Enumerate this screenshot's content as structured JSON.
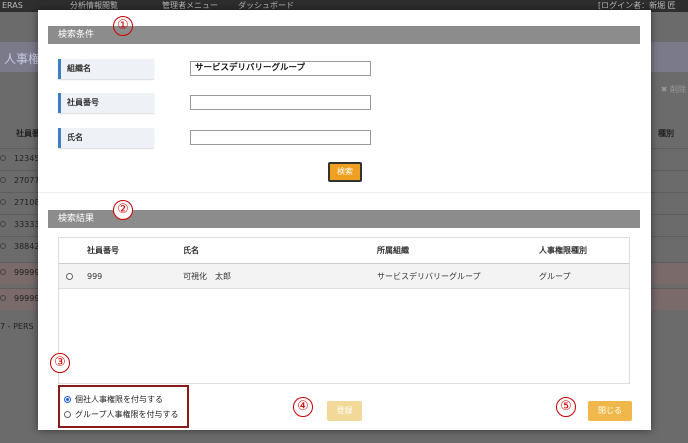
{
  "background": {
    "nav": {
      "brand": "ERAS",
      "menu1": "分析情報閲覧",
      "menu2": "管理者メニュー",
      "menu3": "ダッシュボード",
      "user": "[ログイン者：新堀 匠"
    },
    "page_title": "人事権",
    "delete_label": "削除",
    "column_employee_no": "社員番",
    "column_type": "種別",
    "rows": [
      "12345",
      "27077",
      "27108",
      "33333",
      "38842",
      "99999",
      "99999"
    ],
    "footer": "7 - PERS"
  },
  "modal": {
    "search_section": {
      "title": "検索条件",
      "marker": "①",
      "fields": [
        {
          "label": "組織名",
          "value": ""
        },
        {
          "label": "社員番号",
          "value": ""
        },
        {
          "label": "氏名",
          "value": ""
        }
      ],
      "org_value": "サービスデリバリーグループ",
      "search_button": "検索"
    },
    "results_section": {
      "title": "検索結果",
      "marker": "②",
      "columns": [
        "社員番号",
        "氏名",
        "所属組織",
        "人事権限種別"
      ],
      "rows": [
        {
          "employee_no": "999",
          "name": "可視化　太郎",
          "org": "サービスデリバリーグループ",
          "type": "グループ"
        }
      ]
    },
    "permission": {
      "marker": "③",
      "options": [
        "個社人事権限を付与する",
        "グループ人事権限を付与する"
      ],
      "selected_index": 0
    },
    "register": {
      "marker": "④",
      "label": "登録"
    },
    "close": {
      "marker": "⑤",
      "label": "閉じる"
    }
  },
  "colors": {
    "accent_blue": "#3b7fc4",
    "section_bar": "#8c8c8c",
    "search_button": "#f0a020",
    "register_button": "#f2d99a",
    "close_button": "#f0b84a",
    "marker_red": "#c00000"
  }
}
